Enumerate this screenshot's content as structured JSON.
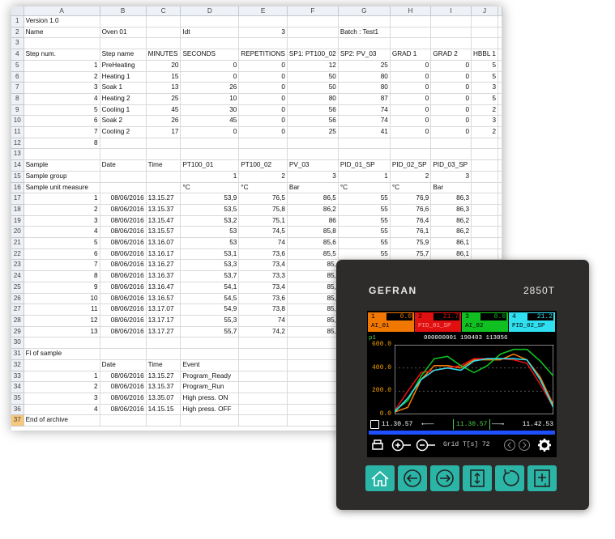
{
  "spreadsheet": {
    "col_headers": [
      "A",
      "B",
      "C",
      "D",
      "E",
      "F",
      "G",
      "H",
      "I",
      "J"
    ],
    "rows": [
      {
        "n": "1",
        "cells": [
          "Version 1.0",
          "",
          "",
          "",
          "",
          "",
          "",
          "",
          "",
          ""
        ]
      },
      {
        "n": "2",
        "cells": [
          "Name",
          "Oven 01",
          "",
          "Idt",
          "3",
          "",
          "Batch : Test1",
          "",
          "",
          ""
        ]
      },
      {
        "n": "3",
        "cells": [
          "",
          "",
          "",
          "",
          "",
          "",
          "",
          "",
          "",
          ""
        ]
      },
      {
        "n": "4",
        "cells": [
          "Step num.",
          "Step name",
          "MINUTES",
          "SECONDS",
          "REPETITIONS",
          "SP1: PT100_02",
          "SP2: PV_03",
          "GRAD 1",
          "GRAD 2",
          "HBBL 1"
        ]
      },
      {
        "n": "5",
        "cells": [
          "1",
          "PreHeating",
          "20",
          "0",
          "0",
          "12",
          "25",
          "0",
          "0",
          "5"
        ]
      },
      {
        "n": "6",
        "cells": [
          "2",
          "Heating 1",
          "15",
          "0",
          "0",
          "50",
          "80",
          "0",
          "0",
          "5"
        ]
      },
      {
        "n": "7",
        "cells": [
          "3",
          "Soak 1",
          "13",
          "26",
          "0",
          "50",
          "80",
          "0",
          "0",
          "3"
        ]
      },
      {
        "n": "8",
        "cells": [
          "4",
          "Heating 2",
          "25",
          "10",
          "0",
          "80",
          "87",
          "0",
          "0",
          "5"
        ]
      },
      {
        "n": "9",
        "cells": [
          "5",
          "Cooling 1",
          "45",
          "30",
          "0",
          "56",
          "74",
          "0",
          "0",
          "2"
        ]
      },
      {
        "n": "10",
        "cells": [
          "6",
          "Soak 2",
          "26",
          "45",
          "0",
          "56",
          "74",
          "0",
          "0",
          "3"
        ]
      },
      {
        "n": "11",
        "cells": [
          "7",
          "Cooling 2",
          "17",
          "0",
          "0",
          "25",
          "41",
          "0",
          "0",
          "2"
        ]
      },
      {
        "n": "12",
        "cells": [
          "8",
          "",
          "",
          "",
          "",
          "",
          "",
          "",
          "",
          ""
        ]
      },
      {
        "n": "13",
        "cells": [
          "",
          "",
          "",
          "",
          "",
          "",
          "",
          "",
          "",
          ""
        ]
      },
      {
        "n": "14",
        "cells": [
          "Sample",
          "Date",
          "Time",
          "PT100_01",
          "PT100_02",
          "PV_03",
          "PID_01_SP",
          "PID_02_SP",
          "PID_03_SP",
          ""
        ]
      },
      {
        "n": "15",
        "cells": [
          "Sample group",
          "",
          "",
          "1",
          "2",
          "3",
          "1",
          "2",
          "3",
          ""
        ]
      },
      {
        "n": "16",
        "cells": [
          "Sample unit measure",
          "",
          "",
          "°C",
          "°C",
          "Bar",
          "°C",
          "°C",
          "Bar",
          ""
        ]
      },
      {
        "n": "17",
        "cells": [
          "1",
          "08/06/2016",
          "13.15.27",
          "53,9",
          "76,5",
          "86,5",
          "55",
          "76,9",
          "86,3",
          ""
        ]
      },
      {
        "n": "18",
        "cells": [
          "2",
          "08/06/2016",
          "13.15.37",
          "53,5",
          "75,8",
          "86,2",
          "55",
          "76,6",
          "86,3",
          ""
        ]
      },
      {
        "n": "19",
        "cells": [
          "3",
          "08/06/2016",
          "13.15.47",
          "53,2",
          "75,1",
          "86",
          "55",
          "76,4",
          "86,2",
          ""
        ]
      },
      {
        "n": "20",
        "cells": [
          "4",
          "08/06/2016",
          "13.15.57",
          "53",
          "74,5",
          "85,8",
          "55",
          "76,1",
          "86,2",
          ""
        ]
      },
      {
        "n": "21",
        "cells": [
          "5",
          "08/06/2016",
          "13.16.07",
          "53",
          "74",
          "85,6",
          "55",
          "75,9",
          "86,1",
          ""
        ]
      },
      {
        "n": "22",
        "cells": [
          "6",
          "08/06/2016",
          "13.16.17",
          "53,1",
          "73,6",
          "85,5",
          "55",
          "75,7",
          "86,1",
          ""
        ]
      },
      {
        "n": "23",
        "cells": [
          "7",
          "08/06/2016",
          "13.16.27",
          "53,3",
          "73,4",
          "85,",
          "",
          "",
          "",
          ""
        ]
      },
      {
        "n": "24",
        "cells": [
          "8",
          "08/06/2016",
          "13.16.37",
          "53,7",
          "73,3",
          "85,",
          "",
          "",
          "",
          ""
        ]
      },
      {
        "n": "25",
        "cells": [
          "9",
          "08/06/2016",
          "13.16.47",
          "54,1",
          "73,4",
          "85,",
          "",
          "",
          "",
          ""
        ]
      },
      {
        "n": "26",
        "cells": [
          "10",
          "08/06/2016",
          "13.16.57",
          "54,5",
          "73,6",
          "85,",
          "",
          "",
          "",
          ""
        ]
      },
      {
        "n": "27",
        "cells": [
          "11",
          "08/06/2016",
          "13.17.07",
          "54,9",
          "73,8",
          "85,",
          "",
          "",
          "",
          ""
        ]
      },
      {
        "n": "28",
        "cells": [
          "12",
          "08/06/2016",
          "13.17.17",
          "55,3",
          "74",
          "85,",
          "",
          "",
          "",
          ""
        ]
      },
      {
        "n": "29",
        "cells": [
          "13",
          "08/06/2016",
          "13.17.27",
          "55,7",
          "74,2",
          "85,",
          "",
          "",
          "",
          ""
        ]
      },
      {
        "n": "30",
        "cells": [
          "",
          "",
          "",
          "",
          "",
          "",
          "",
          "",
          "",
          ""
        ]
      },
      {
        "n": "31",
        "cells": [
          "Fl of sample",
          "",
          "",
          "",
          "",
          "",
          "",
          "",
          "",
          ""
        ]
      },
      {
        "n": "32",
        "cells": [
          "",
          "Date",
          "Time",
          "Event",
          "",
          "",
          "",
          "",
          "",
          ""
        ]
      },
      {
        "n": "33",
        "cells": [
          "1",
          "08/06/2016",
          "13.15.27",
          "Program_Ready",
          "",
          "",
          "",
          "",
          "",
          ""
        ]
      },
      {
        "n": "34",
        "cells": [
          "2",
          "08/06/2016",
          "13.15.37",
          "Program_Run",
          "",
          "",
          "",
          "",
          "",
          ""
        ]
      },
      {
        "n": "35",
        "cells": [
          "3",
          "08/06/2016",
          "13.35.07",
          "High press. ON",
          "",
          "",
          "",
          "",
          "",
          ""
        ]
      },
      {
        "n": "36",
        "cells": [
          "4",
          "08/06/2016",
          "14.15.15",
          "High press. OFF",
          "",
          "",
          "",
          "",
          "",
          ""
        ]
      },
      {
        "n": "37",
        "cells": [
          "End of archive",
          "",
          "",
          "",
          "",
          "",
          "",
          "",
          "",
          ""
        ]
      }
    ]
  },
  "device": {
    "brand": "GEFRAN",
    "model": "2850T",
    "channels": [
      {
        "index": "1",
        "value": "0.0",
        "name": "AI_01",
        "color": "#f07800",
        "namecolor": "#000000"
      },
      {
        "index": "2",
        "value": "21.7",
        "name": "PID_01_SP",
        "color": "#e01010",
        "namecolor": "#ff9a9a"
      },
      {
        "index": "3",
        "value": "0.0",
        "name": "AI_02",
        "color": "#10c020",
        "namecolor": "#000000"
      },
      {
        "index": "4",
        "value": "21.2",
        "name": "PID_02_SP",
        "color": "#30e0f0",
        "namecolor": "#000000"
      }
    ],
    "program": "p1",
    "info_line": "000000001 190403 113056",
    "y_ticks": [
      "600.0",
      "400.0",
      "200.0",
      "0.0"
    ],
    "time_start": "11.30.57",
    "time_cursor": "11.30.57",
    "time_end": "11.42.53",
    "toolbar_text": "Grid T[s] 72",
    "keys": [
      "home-icon",
      "back-arrow-icon",
      "forward-arrow-icon",
      "scroll-updown-icon",
      "refresh-icon",
      "add-icon"
    ]
  },
  "chart_data": {
    "type": "line",
    "ylim": [
      0,
      600
    ],
    "y_ticks": [
      "600.0",
      "400.0",
      "200.0",
      "0.0"
    ],
    "x": [
      0,
      1,
      2,
      3,
      4,
      5,
      6,
      7,
      8,
      9,
      10,
      11,
      12
    ],
    "series": [
      {
        "color": "#f07800",
        "values": [
          20,
          60,
          300,
          420,
          420,
          400,
          470,
          470,
          470,
          520,
          470,
          320,
          80
        ]
      },
      {
        "color": "#e01010",
        "values": [
          30,
          200,
          360,
          380,
          400,
          420,
          480,
          480,
          480,
          470,
          440,
          260,
          60
        ]
      },
      {
        "color": "#10c020",
        "values": [
          30,
          120,
          330,
          480,
          500,
          420,
          360,
          420,
          520,
          560,
          560,
          460,
          330
        ]
      },
      {
        "color": "#30e0f0",
        "values": [
          20,
          140,
          300,
          380,
          400,
          380,
          460,
          480,
          480,
          480,
          470,
          300,
          60
        ]
      }
    ]
  }
}
